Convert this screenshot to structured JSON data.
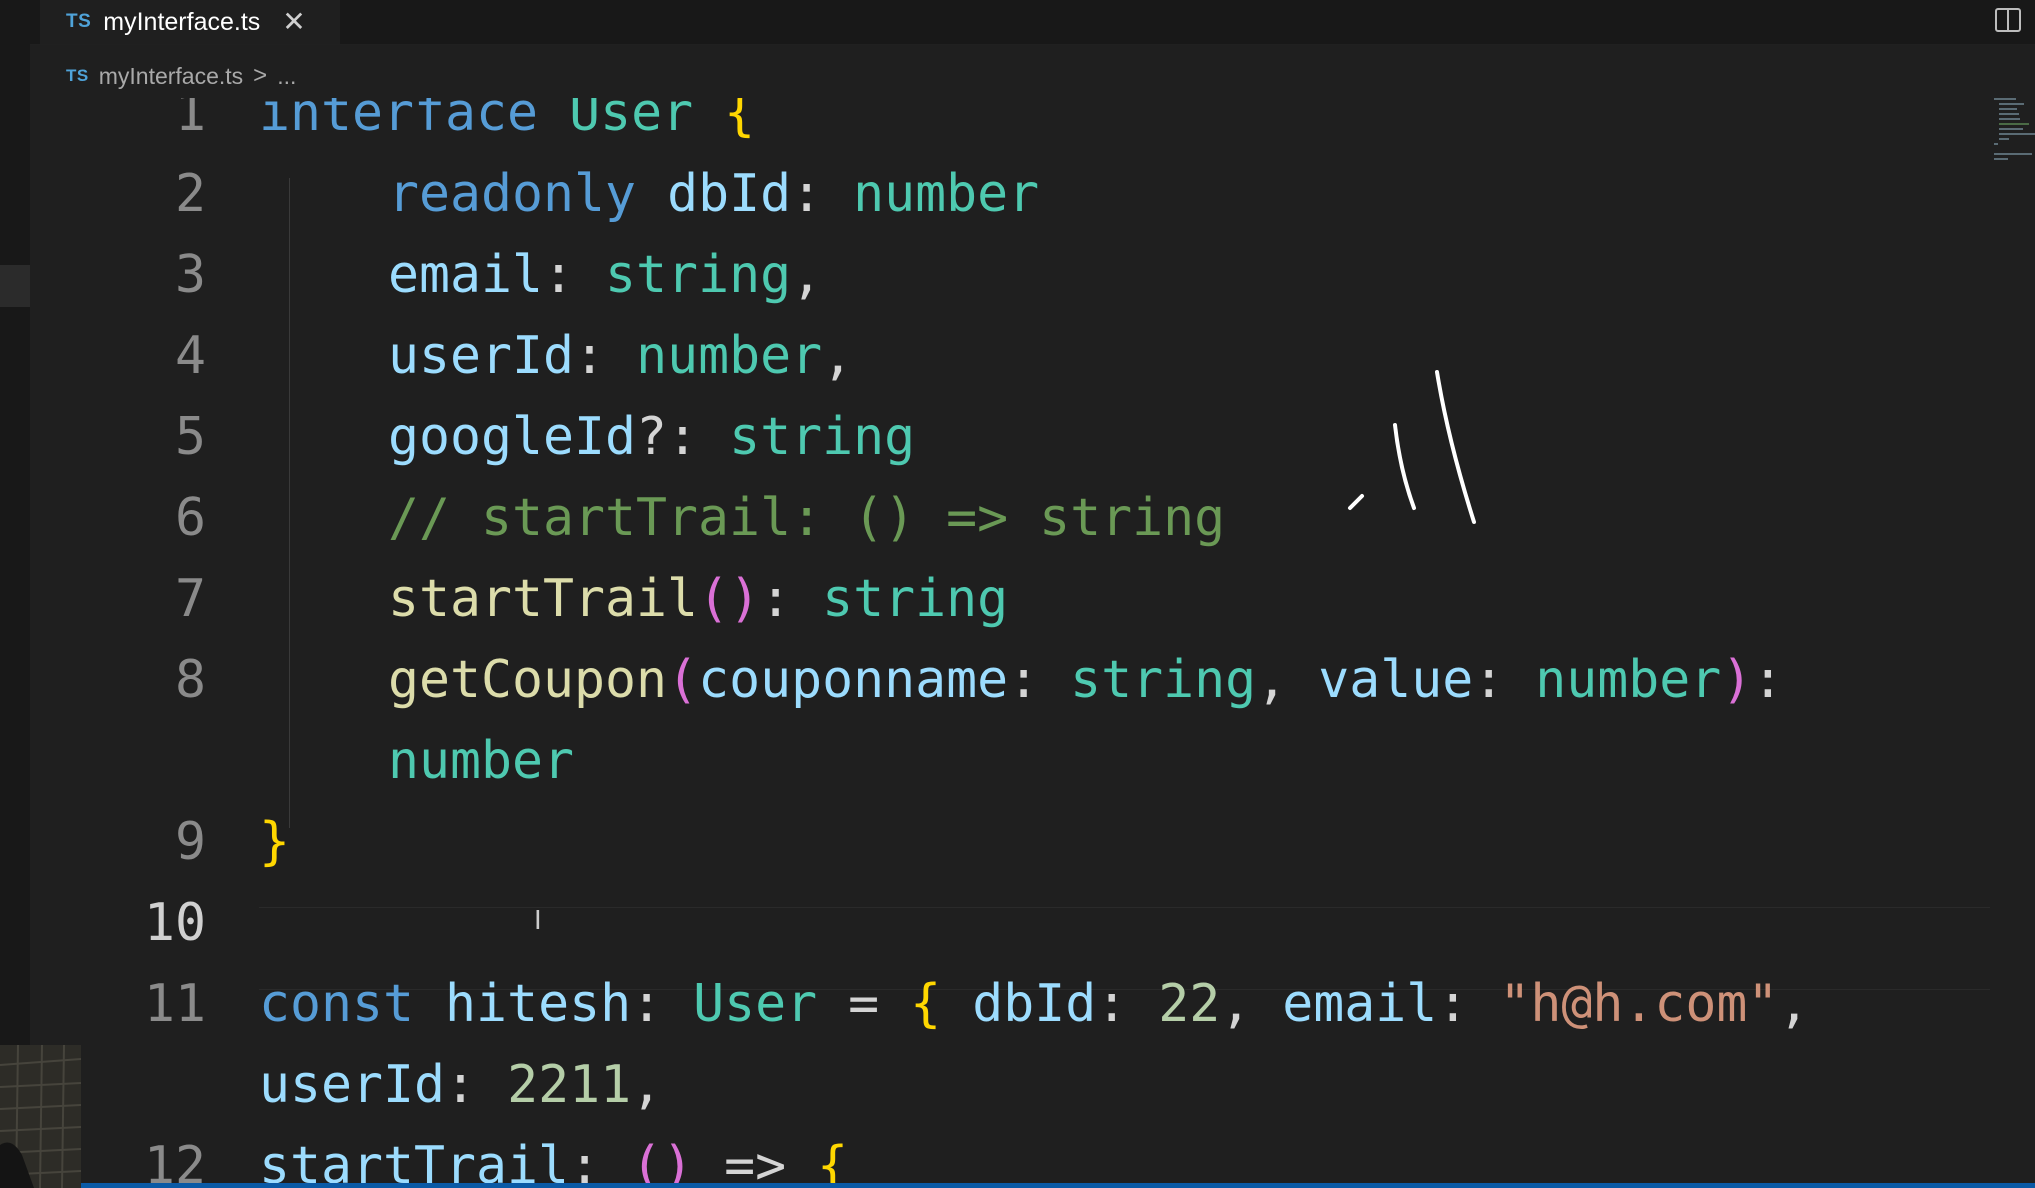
{
  "tab": {
    "badge": "TS",
    "name": "myInterface.ts",
    "close": "✕"
  },
  "breadcrumb": {
    "badge": "TS",
    "file": "myInterface.ts",
    "separator": ">",
    "more": "..."
  },
  "icons": {
    "close": "close-icon",
    "split": "split-editor-icon",
    "cursor": "text-cursor-icon",
    "chevron": "chevron-right-icon"
  },
  "editor": {
    "line_numbers": [
      "1",
      "2",
      "3",
      "4",
      "5",
      "6",
      "7",
      "8",
      "9",
      "10",
      "11",
      "12"
    ],
    "lines": [
      [
        {
          "t": "interface",
          "c": "kw"
        },
        {
          "t": " "
        },
        {
          "t": "User",
          "c": "type"
        },
        {
          "t": " "
        },
        {
          "t": "{",
          "c": "brace"
        }
      ],
      [
        {
          "t": "readonly",
          "c": "kw"
        },
        {
          "t": " "
        },
        {
          "t": "dbId",
          "c": "prop"
        },
        {
          "t": ": "
        },
        {
          "t": "number",
          "c": "type"
        }
      ],
      [
        {
          "t": "email",
          "c": "prop"
        },
        {
          "t": ": "
        },
        {
          "t": "string",
          "c": "type"
        },
        {
          "t": ","
        }
      ],
      [
        {
          "t": "userId",
          "c": "prop"
        },
        {
          "t": ": "
        },
        {
          "t": "number",
          "c": "type"
        },
        {
          "t": ","
        }
      ],
      [
        {
          "t": "googleId",
          "c": "prop"
        },
        {
          "t": "?: "
        },
        {
          "t": "string",
          "c": "type"
        }
      ],
      [
        {
          "t": "// startTrail: () => string",
          "c": "cmt"
        }
      ],
      [
        {
          "t": "startTrail",
          "c": "fn"
        },
        {
          "t": "()",
          "c": "paren"
        },
        {
          "t": ": "
        },
        {
          "t": "string",
          "c": "type"
        }
      ],
      [
        {
          "t": "getCoupon",
          "c": "fn"
        },
        {
          "t": "(",
          "c": "paren"
        },
        {
          "t": "couponname",
          "c": "prop"
        },
        {
          "t": ": "
        },
        {
          "t": "string",
          "c": "type"
        },
        {
          "t": ", "
        },
        {
          "t": "value",
          "c": "prop"
        },
        {
          "t": ": "
        },
        {
          "t": "number",
          "c": "type"
        },
        {
          "t": ")",
          "c": "paren"
        },
        {
          "t": ":"
        }
      ],
      [
        {
          "t": "number",
          "c": "type"
        }
      ],
      [
        {
          "t": "}",
          "c": "brace"
        }
      ],
      [],
      [
        {
          "t": "const",
          "c": "kw"
        },
        {
          "t": " "
        },
        {
          "t": "hitesh",
          "c": "prop"
        },
        {
          "t": ": "
        },
        {
          "t": "User",
          "c": "type"
        },
        {
          "t": " = "
        },
        {
          "t": "{",
          "c": "brace"
        },
        {
          "t": " "
        },
        {
          "t": "dbId",
          "c": "prop"
        },
        {
          "t": ": "
        },
        {
          "t": "22",
          "c": "num"
        },
        {
          "t": ", "
        },
        {
          "t": "email",
          "c": "prop"
        },
        {
          "t": ": "
        },
        {
          "t": "\"h@h.com\"",
          "c": "str"
        },
        {
          "t": ","
        }
      ],
      [
        {
          "t": "userId",
          "c": "prop"
        },
        {
          "t": ": "
        },
        {
          "t": "2211",
          "c": "num"
        },
        {
          "t": ","
        }
      ],
      [
        {
          "t": "startTrail",
          "c": "prop"
        },
        {
          "t": ": "
        },
        {
          "t": "()",
          "c": "paren"
        },
        {
          "t": " => "
        },
        {
          "t": "{",
          "c": "brace"
        }
      ]
    ]
  },
  "colors": {
    "background": "#1f1f1f",
    "keyword": "#569cd6",
    "type": "#4ec9b0",
    "property": "#9cdcfe",
    "brace": "#ffd700",
    "paren": "#da70d6",
    "function": "#dcdcaa",
    "string": "#ce9178",
    "number": "#b5cea8",
    "comment": "#6a9955",
    "status_bar": "#0a5aa6"
  }
}
